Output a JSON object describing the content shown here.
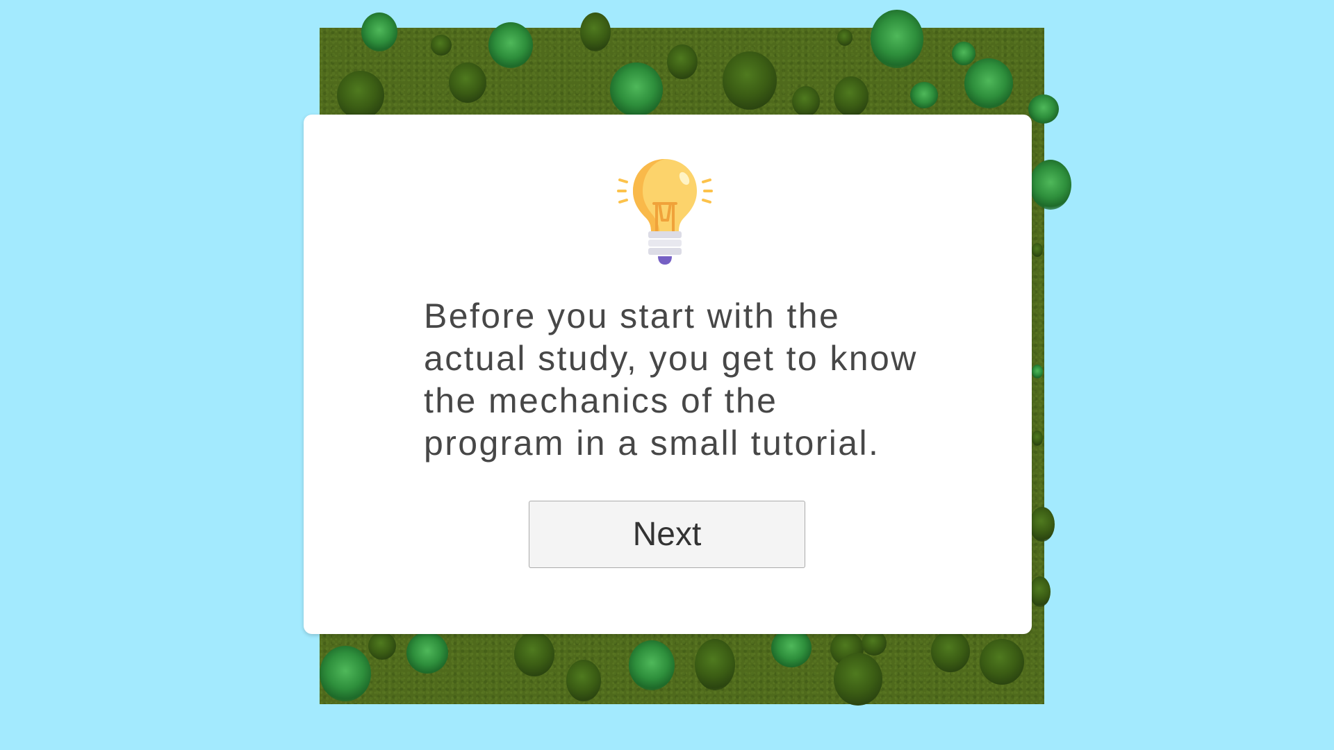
{
  "dialog": {
    "icon": "lightbulb-icon",
    "message": "Before you start with the actual study, you get to know the mechanics of the program in a small tutorial.",
    "next_label": "Next"
  },
  "colors": {
    "sky_background": "#a3eafe",
    "map_ground": "#4f6a1c",
    "dialog_background": "#ffffff",
    "text": "#474747",
    "button_background": "#f4f4f4",
    "bulb_glass": "#fcd36b"
  },
  "background": {
    "scene": "top-down forest map with conifer and leafy trees"
  }
}
